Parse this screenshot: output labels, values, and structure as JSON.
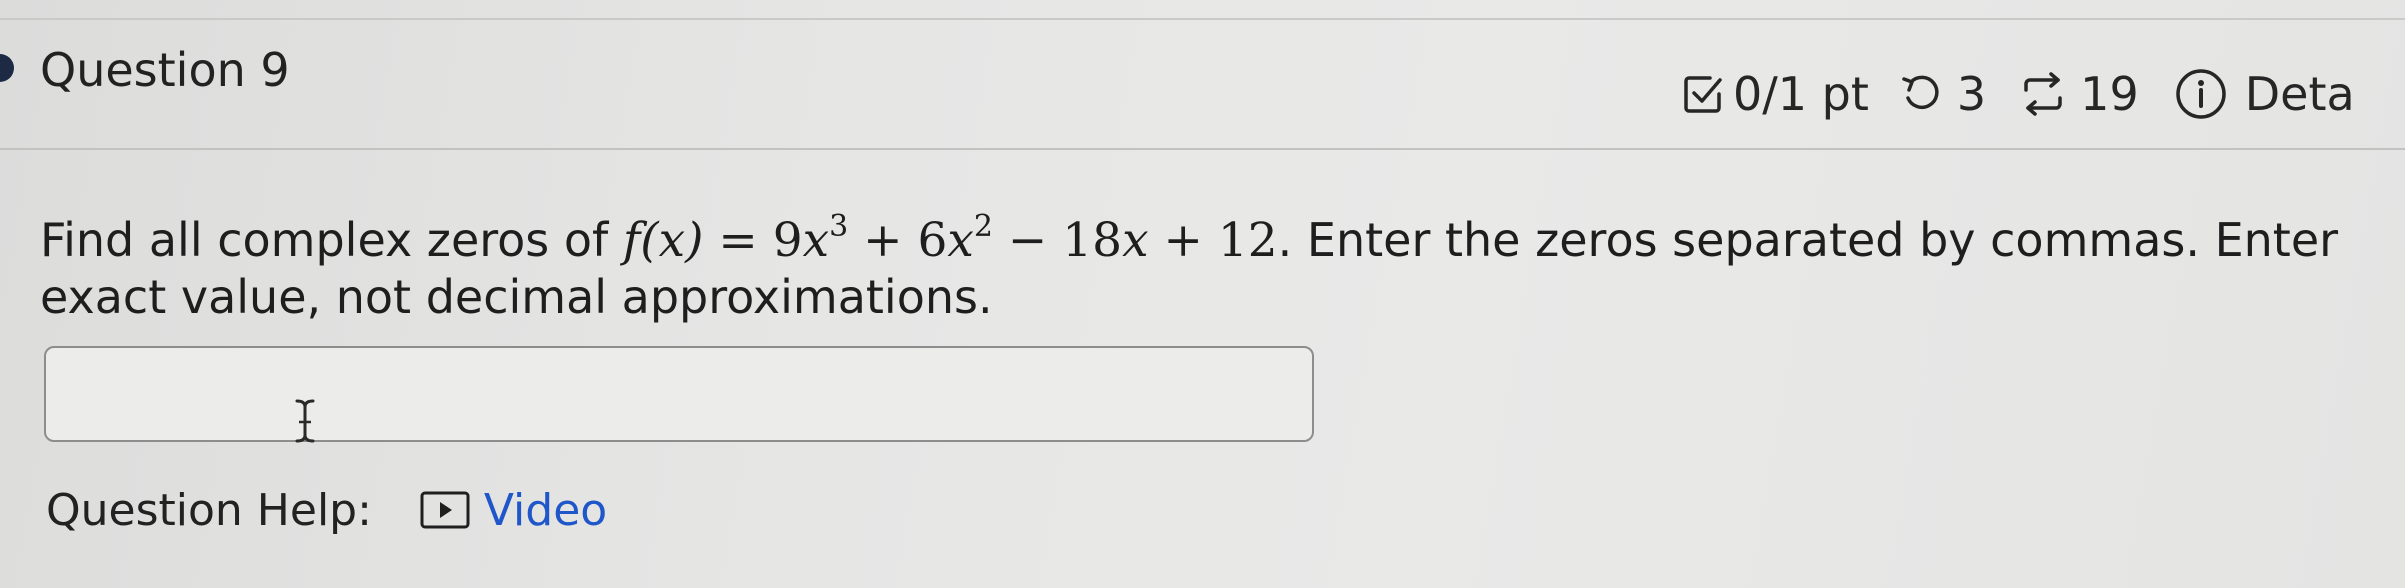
{
  "question": {
    "title": "Question 9",
    "score": "0/1 pt",
    "retries": "3",
    "submissions": "19",
    "details_label": "Deta"
  },
  "prompt": {
    "before": "Find all complex zeros of ",
    "fx": "f(x)",
    "equals": " = ",
    "c1": "9",
    "x": "x",
    "exp1": "3",
    "plus1": " + ",
    "c2": "6",
    "exp2": "2",
    "minus": " − ",
    "c3": "18",
    "plus2": " + ",
    "c4": "12",
    "after": ". Enter the zeros separated by commas. Enter exact value, not decimal approximations."
  },
  "answer": {
    "value": "",
    "placeholder": ""
  },
  "help": {
    "label": "Question Help:",
    "video_label": "Video"
  },
  "colors": {
    "link": "#1f56c9",
    "bullet": "#1d2a44"
  },
  "icons": [
    "checkbox-icon",
    "retry-icon",
    "submissions-icon",
    "info-icon",
    "text-cursor-icon",
    "play-icon"
  ]
}
